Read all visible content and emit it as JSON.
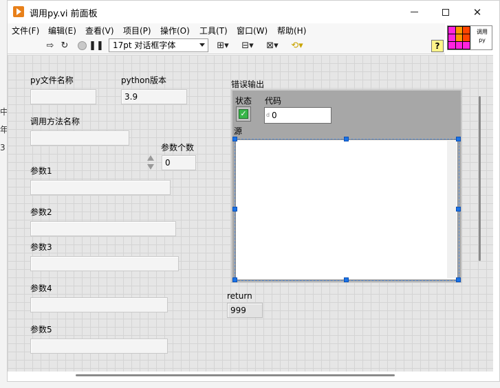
{
  "window": {
    "title": "调用py.vi 前面板"
  },
  "menu": [
    "文件(F)",
    "编辑(E)",
    "查看(V)",
    "项目(P)",
    "操作(O)",
    "工具(T)",
    "窗口(W)",
    "帮助(H)"
  ],
  "toolbar": {
    "font": "17pt 对话框字体",
    "help": "?"
  },
  "vi_icon": {
    "text": "调用 py"
  },
  "controls": {
    "py_file_label": "py文件名称",
    "py_file_value": "",
    "python_version_label": "python版本",
    "python_version_value": "3.9",
    "method_label": "调用方法名称",
    "method_value": "",
    "param_count_label": "参数个数",
    "param_count_value": "0",
    "param1_label": "参数1",
    "param1_value": "",
    "param2_label": "参数2",
    "param2_value": "",
    "param3_label": "参数3",
    "param3_value": "",
    "param4_label": "参数4",
    "param4_value": "",
    "param5_label": "参数5",
    "param5_value": ""
  },
  "error_out": {
    "label": "错误输出",
    "status_label": "状态",
    "code_label": "代码",
    "code_value": "0",
    "code_prefix": "d",
    "source_label": "源",
    "source_value": ""
  },
  "return": {
    "label": "return",
    "value": "999"
  },
  "desk_strip": [
    "中",
    "年",
    "3"
  ]
}
